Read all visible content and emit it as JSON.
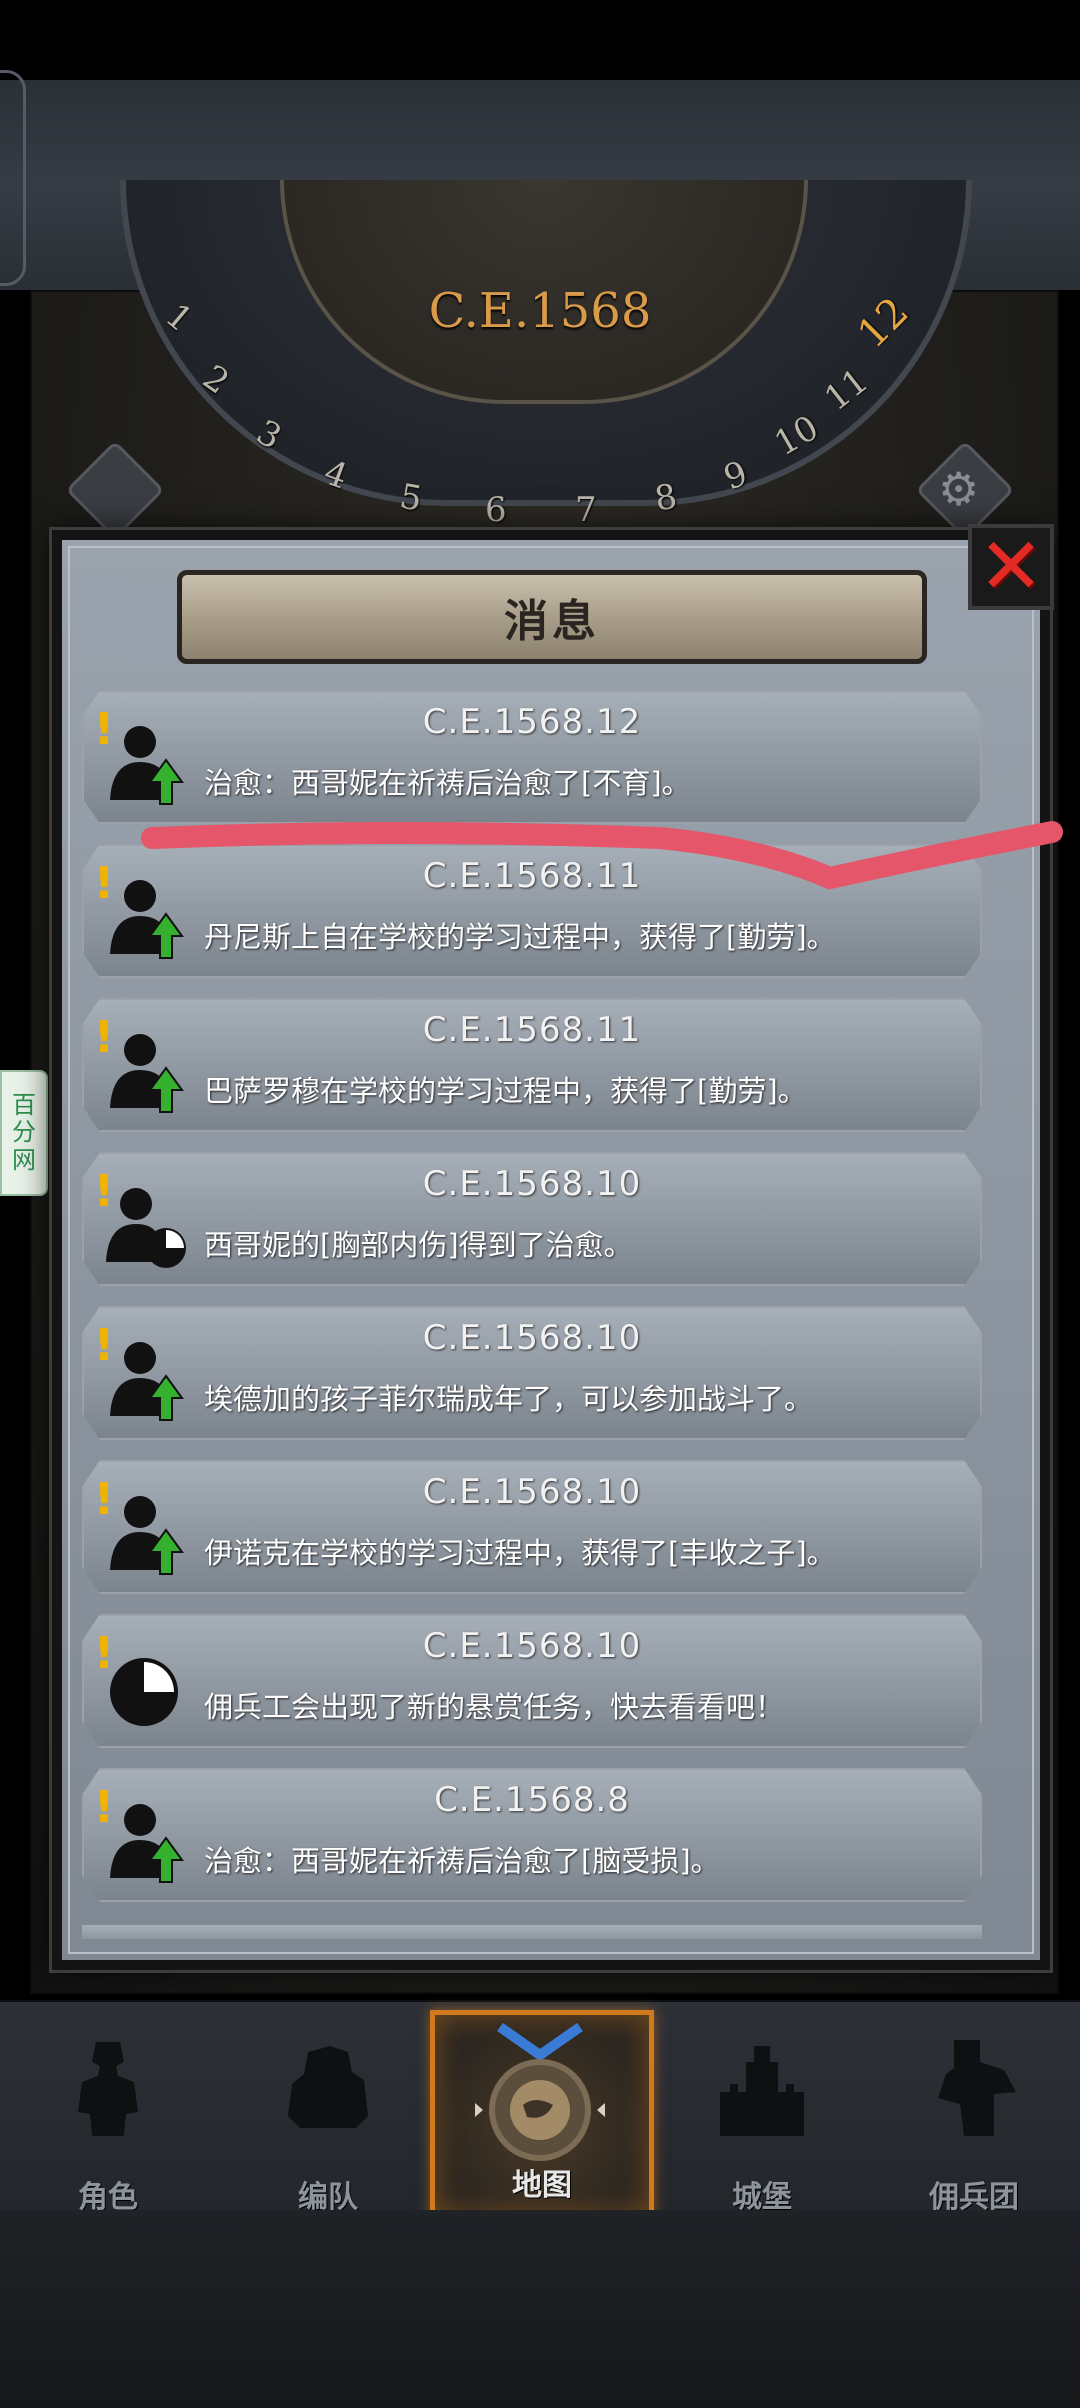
{
  "calendar": {
    "year": "C.E.1568",
    "months": [
      "1",
      "2",
      "3",
      "4",
      "5",
      "6",
      "7",
      "8",
      "9",
      "10",
      "11",
      "12"
    ],
    "current_month": "12"
  },
  "dialog": {
    "title": "消息",
    "close_label": "✕"
  },
  "messages": [
    {
      "date": "C.E.1568.12",
      "text": "治愈：西哥妮在祈祷后治愈了[不育]。",
      "icon": "person-up-icon"
    },
    {
      "date": "C.E.1568.11",
      "text": "丹尼斯上自在学校的学习过程中，获得了[勤劳]。",
      "icon": "person-up-icon"
    },
    {
      "date": "C.E.1568.11",
      "text": "巴萨罗穆在学校的学习过程中，获得了[勤劳]。",
      "icon": "person-up-icon"
    },
    {
      "date": "C.E.1568.10",
      "text": "西哥妮的[胸部内伤]得到了治愈。",
      "icon": "person-clock-icon"
    },
    {
      "date": "C.E.1568.10",
      "text": "埃德加的孩子菲尔瑞成年了，可以参加战斗了。",
      "icon": "person-up-icon"
    },
    {
      "date": "C.E.1568.10",
      "text": "伊诺克在学校的学习过程中，获得了[丰收之子]。",
      "icon": "person-up-icon"
    },
    {
      "date": "C.E.1568.10",
      "text": "佣兵工会出现了新的悬赏任务，快去看看吧！",
      "icon": "clock-icon"
    },
    {
      "date": "C.E.1568.8",
      "text": "治愈：西哥妮在祈祷后治愈了[脑受损]。",
      "icon": "person-up-icon"
    }
  ],
  "side_tag": [
    "百",
    "分",
    "网"
  ],
  "nav": [
    {
      "label": "角色",
      "icon": "knight-icon"
    },
    {
      "label": "编队",
      "icon": "squad-icon"
    },
    {
      "label": "地图",
      "icon": "map-icon",
      "active": true
    },
    {
      "label": "城堡",
      "icon": "castle-icon"
    },
    {
      "label": "佣兵团",
      "icon": "mercenary-icon"
    }
  ],
  "colors": {
    "accent_orange": "#d07a1d",
    "year_gold": "#d99a4a",
    "exclaim_yellow": "#f0b400",
    "arrow_green": "#35b12f",
    "close_red": "#e32a24",
    "annotation_red": "#e5566a"
  }
}
